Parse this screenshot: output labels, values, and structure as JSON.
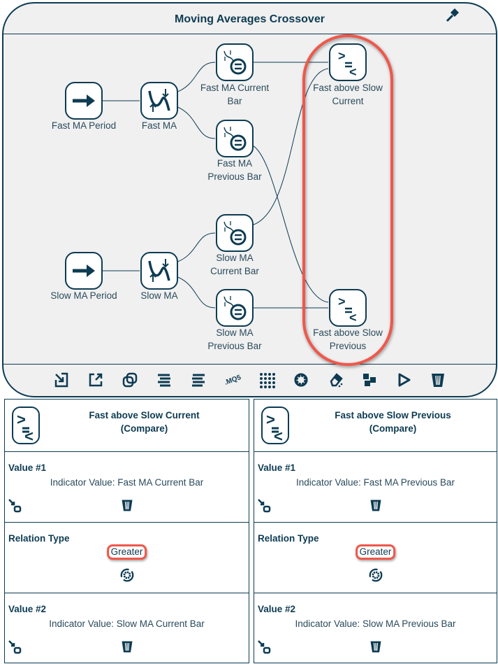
{
  "canvas": {
    "title": "Moving Averages Crossover",
    "nodes": [
      {
        "label1": "Fast MA Period",
        "label2": "",
        "icon": "arrow-right-icon"
      },
      {
        "label1": "Fast MA",
        "label2": "",
        "icon": "moving-average-icon"
      },
      {
        "label1": "Fast MA Current",
        "label2": "Bar",
        "icon": "indicator-value-icon"
      },
      {
        "label1": "Fast MA",
        "label2": "Previous Bar",
        "icon": "indicator-value-icon"
      },
      {
        "label1": "Fast above Slow",
        "label2": "Current",
        "icon": "compare-icon"
      },
      {
        "label1": "Slow MA Period",
        "label2": "",
        "icon": "arrow-right-icon"
      },
      {
        "label1": "Slow MA",
        "label2": "",
        "icon": "moving-average-icon"
      },
      {
        "label1": "Slow MA",
        "label2": "Current Bar",
        "icon": "indicator-value-icon"
      },
      {
        "label1": "Slow MA",
        "label2": "Previous Bar",
        "icon": "indicator-value-icon"
      },
      {
        "label1": "Fast above Slow",
        "label2": "Previous",
        "icon": "compare-icon"
      }
    ],
    "toolbar": [
      "import-icon",
      "export-icon",
      "duplicate-icon",
      "align-left-icon",
      "align-right-icon",
      "mq5-icon",
      "grid-icon",
      "settings-icon",
      "eraser-icon",
      "layout-icon",
      "play-icon",
      "trash-icon"
    ],
    "mq5_label": ".MQ5",
    "highlight_color": "#f0574a",
    "accent_color": "#0d3b52"
  },
  "panels": [
    {
      "title": "Fast above Slow Current",
      "subtitle": "(Compare)",
      "value1_label": "Value #1",
      "value1": "Indicator Value: Fast MA Current Bar",
      "relation_label": "Relation Type",
      "relation": "Greater",
      "value2_label": "Value #2",
      "value2": "Indicator Value: Slow MA Current Bar"
    },
    {
      "title": "Fast above Slow Previous",
      "subtitle": "(Compare)",
      "value1_label": "Value #1",
      "value1": "Indicator Value: Fast MA Previous Bar",
      "relation_label": "Relation Type",
      "relation": "Greater",
      "value2_label": "Value #2",
      "value2": "Indicator Value: Slow MA Previous Bar"
    }
  ]
}
